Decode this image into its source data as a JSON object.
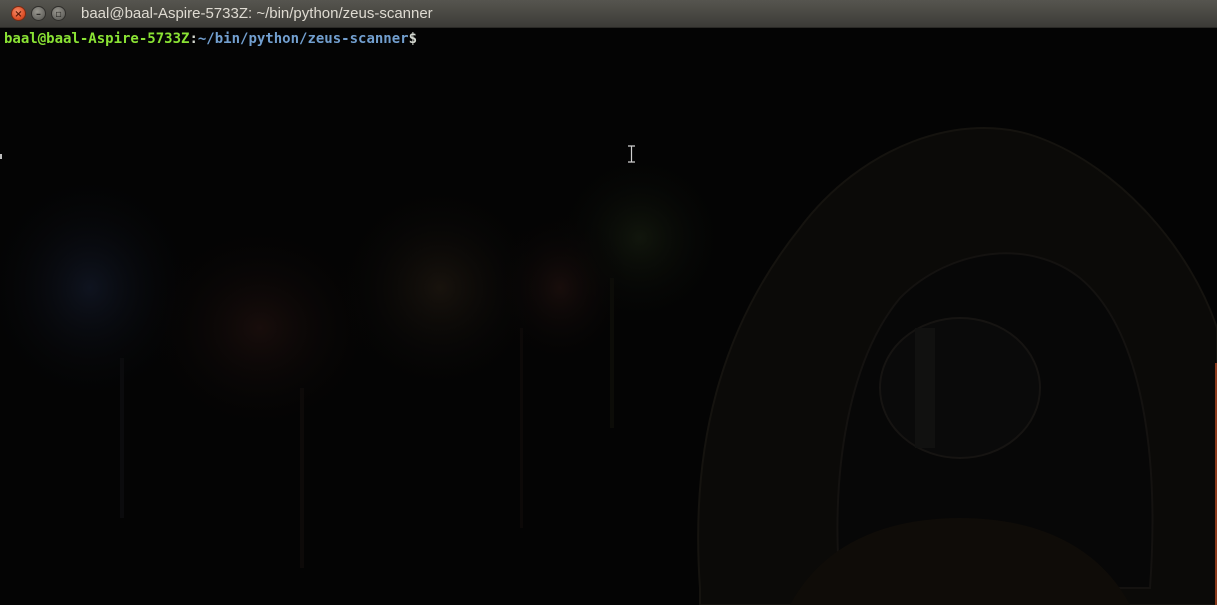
{
  "window": {
    "title": "baal@baal-Aspire-5733Z: ~/bin/python/zeus-scanner",
    "buttons": {
      "close_icon": "close-icon",
      "minimize_icon": "minimize-icon",
      "maximize_icon": "maximize-icon"
    }
  },
  "terminal": {
    "prompt_user": "baal@baal-Aspire-5733Z",
    "prompt_sep": ":",
    "prompt_path": "~/bin/python/zeus-scanner",
    "prompt_symbol": "$",
    "colors": {
      "user": "#8ae234",
      "path": "#729fcf",
      "text": "#d3d7cf",
      "background": "#040404"
    }
  }
}
